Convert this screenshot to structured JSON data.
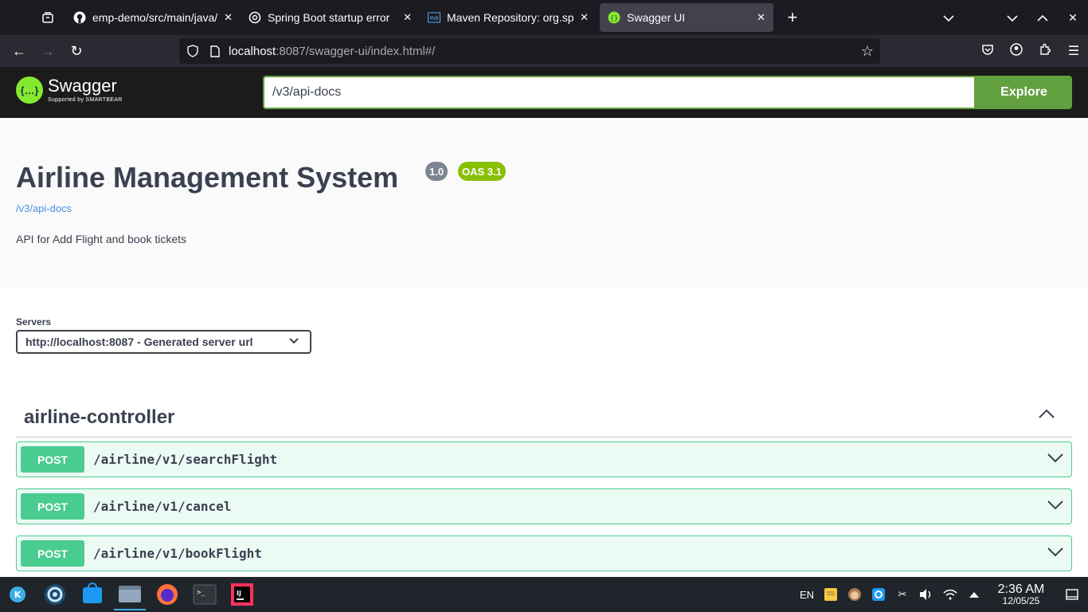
{
  "browser": {
    "tabs": [
      {
        "title": "emp-demo/src/main/java/",
        "icon": "github-icon"
      },
      {
        "title": "Spring Boot startup error",
        "icon": "openai-icon"
      },
      {
        "title": "Maven Repository: org.spr",
        "icon": "maven-icon"
      },
      {
        "title": "Swagger UI",
        "icon": "swagger-icon",
        "active": true
      }
    ],
    "url_host": "localhost",
    "url_rest": ":8087/swagger-ui/index.html#/"
  },
  "swagger": {
    "logo_text": "Swagger",
    "logo_subtext": "Supported by SMARTBEAR",
    "spec_url": "/v3/api-docs",
    "explore_label": "Explore",
    "title": "Airline Management System",
    "version": "1.0",
    "oas": "OAS 3.1",
    "spec_link": "/v3/api-docs",
    "description": "API for Add Flight and book tickets",
    "servers_label": "Servers",
    "server_selected": "http://localhost:8087 - Generated server url",
    "tag": "airline-controller",
    "operations": [
      {
        "method": "POST",
        "path": "/airline/v1/searchFlight"
      },
      {
        "method": "POST",
        "path": "/airline/v1/cancel"
      },
      {
        "method": "POST",
        "path": "/airline/v1/bookFlight"
      }
    ]
  },
  "taskbar": {
    "lang": "EN",
    "time": "2:36 AM",
    "date": "12/05/25"
  },
  "colors": {
    "post_green": "#49cc90",
    "explore_green": "#62a03f",
    "oas_badge": "#89bf04",
    "version_badge": "#7d8492"
  }
}
